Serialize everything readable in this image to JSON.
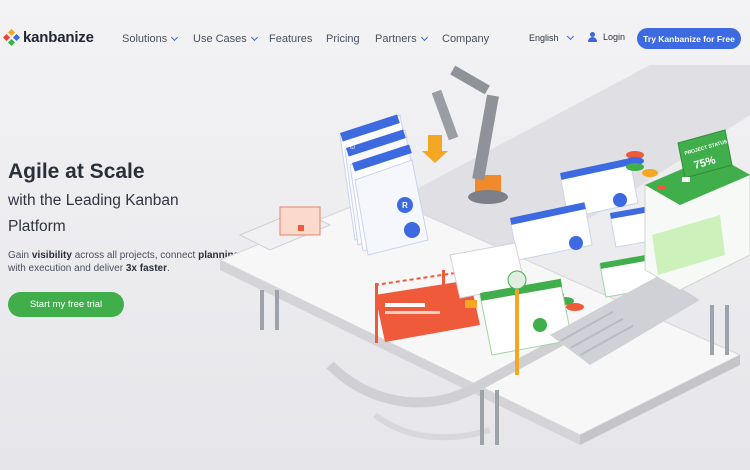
{
  "brand": {
    "name": "kanbanize"
  },
  "nav": {
    "items": [
      {
        "label": "Solutions",
        "dropdown": true
      },
      {
        "label": "Use Cases",
        "dropdown": true
      },
      {
        "label": "Features",
        "dropdown": false
      },
      {
        "label": "Pricing",
        "dropdown": false
      },
      {
        "label": "Partners",
        "dropdown": true
      },
      {
        "label": "Company",
        "dropdown": false
      }
    ],
    "language": "English",
    "login": "Login",
    "cta": "Try Kanbanize for Free"
  },
  "hero": {
    "title": "Agile at Scale",
    "subtitle": "with the Leading Kanban Platform",
    "desc_1": "Gain ",
    "desc_2": "visibility",
    "desc_3": " across all projects, connect ",
    "desc_4": "planning",
    "desc_5": " with execution and deliver ",
    "desc_6": "3x faster",
    "desc_7": ".",
    "button": "Start my free trial"
  },
  "illustration": {
    "status_title": "PROJECT STATUS",
    "status_value": "75%",
    "card_letter": "R",
    "card_code": "ID"
  },
  "colors": {
    "accent_blue": "#3d6ae0",
    "accent_green": "#3fae4b",
    "card_red": "#ee5a3a",
    "machine_orange": "#f08a2a"
  }
}
